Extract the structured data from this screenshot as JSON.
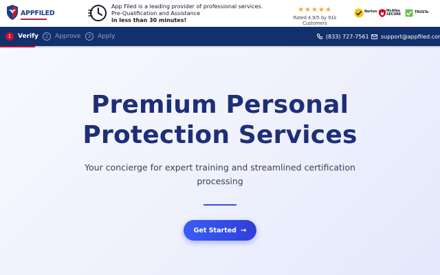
{
  "header": {
    "logo_text": "APPFILED",
    "tagline": {
      "line1": "App Filed is a leading provider of professional services.",
      "line2": "Pre-Qualification and Assistance",
      "line3": "in less than 30 minutes!"
    },
    "rating": {
      "stars": "★★★★★",
      "value": 4.9,
      "text": "Rated 4.9/5 by 91k Customers"
    },
    "badges": [
      {
        "name": "norton",
        "label": "Norton"
      },
      {
        "name": "mcafee",
        "label": "McAfee SECURE"
      },
      {
        "name": "truste",
        "label": "TRUSTe"
      }
    ]
  },
  "nav": {
    "steps": [
      {
        "number": "1",
        "label": "Verify",
        "active": true
      },
      {
        "number": "2",
        "label": "Approve",
        "active": false
      },
      {
        "number": "3",
        "label": "Apply",
        "active": false
      }
    ],
    "phone": "(833) 727-7561",
    "email": "support@appfiled.com",
    "progress": 0.08
  },
  "hero": {
    "title_line1": "Premium Personal",
    "title_line2": "Protection Services",
    "subtitle": "Your concierge for expert training and streamlined certification processing",
    "cta_label": "Get Started",
    "cta_arrow": "→"
  },
  "colors": {
    "navbar": "#12306b",
    "accent_red": "#c8102e",
    "title": "#1e2f78",
    "cta": "#3b5cf5",
    "star": "#f5a623"
  }
}
